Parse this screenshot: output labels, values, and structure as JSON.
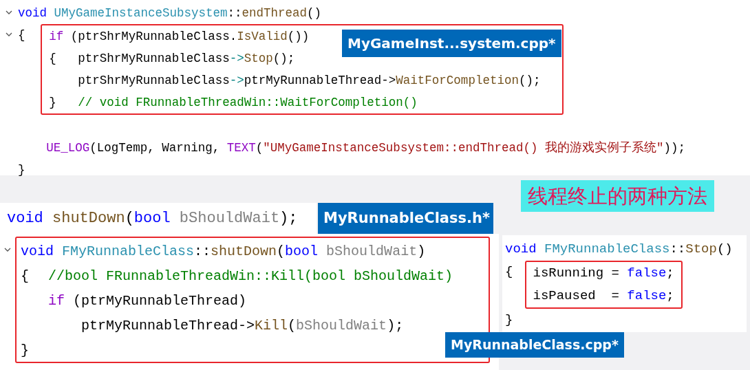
{
  "top_panel": {
    "file_tab": "MyGameInst...system.cpp*",
    "framed": false,
    "head_expanded": true,
    "lead_expanded": true,
    "head": [
      {
        "kind": "kw",
        "text": "void "
      },
      {
        "kind": "cls",
        "text": "UMyGameInstanceSubsystem"
      },
      {
        "kind": "plain",
        "text": "::"
      },
      {
        "kind": "fn",
        "text": "endThread"
      },
      {
        "kind": "plain",
        "text": "()"
      }
    ],
    "lead": "{",
    "groups": [
      {
        "framed": true,
        "lines": [
          [
            {
              "kind": "ctl",
              "text": "if"
            },
            {
              "kind": "plain",
              "text": " (ptrShrMyRunnableClass."
            },
            {
              "kind": "fn",
              "text": "IsValid"
            },
            {
              "kind": "plain",
              "text": "())"
            }
          ],
          [
            {
              "kind": "plain",
              "text": "{   ptrShrMyRunnableClass"
            },
            {
              "kind": "op",
              "text": "->"
            },
            {
              "kind": "fn",
              "text": "Stop"
            },
            {
              "kind": "plain",
              "text": "();"
            }
          ],
          [
            {
              "kind": "plain",
              "text": "    ptrShrMyRunnableClass"
            },
            {
              "kind": "op",
              "text": "->"
            },
            {
              "kind": "plain",
              "text": "ptrMyRunnableThread->"
            },
            {
              "kind": "fn",
              "text": "WaitForCompletion"
            },
            {
              "kind": "plain",
              "text": "();"
            }
          ],
          [
            {
              "kind": "plain",
              "text": "}   "
            },
            {
              "kind": "cmt",
              "text": "// void FRunnableThreadWin::WaitForCompletion()"
            }
          ]
        ]
      },
      {
        "framed": false,
        "lines": [
          [
            {
              "kind": "ctl",
              "text": "UE_LOG"
            },
            {
              "kind": "plain",
              "text": "(LogTemp, Warning, "
            },
            {
              "kind": "ctl",
              "text": "TEXT"
            },
            {
              "kind": "plain",
              "text": "("
            },
            {
              "kind": "str",
              "text": "\"UMyGameInstanceSubsystem::endThread() 我的游戏实例子系统\""
            },
            {
              "kind": "plain",
              "text": "));"
            }
          ]
        ]
      }
    ],
    "close": "}"
  },
  "title_label": "线程终止的两种方法",
  "declaration": {
    "file_tab": "MyRunnableClass.h*",
    "tokens": [
      {
        "kind": "kw",
        "text": "void "
      },
      {
        "kind": "fn",
        "text": "shutDown"
      },
      {
        "kind": "plain",
        "text": "("
      },
      {
        "kind": "kw",
        "text": "bool "
      },
      {
        "kind": "param",
        "text": "bShouldWait"
      },
      {
        "kind": "plain",
        "text": ");"
      }
    ]
  },
  "left_panel": {
    "file_tab": "MyRunnableClass.cpp*",
    "framed": true,
    "head_expanded": true,
    "head": [
      {
        "kind": "kw",
        "text": "void "
      },
      {
        "kind": "cls",
        "text": "FMyRunnableClass"
      },
      {
        "kind": "plain",
        "text": "::"
      },
      {
        "kind": "fn",
        "text": "shutDown"
      },
      {
        "kind": "plain",
        "text": "("
      },
      {
        "kind": "kw",
        "text": "bool "
      },
      {
        "kind": "param",
        "text": "bShouldWait"
      },
      {
        "kind": "plain",
        "text": ")"
      }
    ],
    "lead": "{",
    "groups": [
      {
        "framed": false,
        "lines": [
          [
            {
              "kind": "cmt",
              "text": "//bool FRunnableThreadWin::Kill(bool bShouldWait)"
            }
          ],
          [
            {
              "kind": "ctl",
              "text": "if"
            },
            {
              "kind": "plain",
              "text": " (ptrMyRunnableThread)"
            }
          ],
          [
            {
              "kind": "plain",
              "text": "    ptrMyRunnableThread->"
            },
            {
              "kind": "fn",
              "text": "Kill"
            },
            {
              "kind": "plain",
              "text": "("
            },
            {
              "kind": "param",
              "text": "bShouldWait"
            },
            {
              "kind": "plain",
              "text": ");"
            }
          ]
        ]
      }
    ],
    "close": "}"
  },
  "right_panel": {
    "framed": false,
    "head": [
      {
        "kind": "kw",
        "text": "void "
      },
      {
        "kind": "cls",
        "text": "FMyRunnableClass"
      },
      {
        "kind": "plain",
        "text": "::"
      },
      {
        "kind": "fn",
        "text": "Stop"
      },
      {
        "kind": "plain",
        "text": "()"
      }
    ],
    "lead": "{",
    "groups": [
      {
        "framed": true,
        "lines": [
          [
            {
              "kind": "plain",
              "text": "isRunning = "
            },
            {
              "kind": "kw",
              "text": "false"
            },
            {
              "kind": "plain",
              "text": ";"
            }
          ],
          [
            {
              "kind": "plain",
              "text": "isPaused  = "
            },
            {
              "kind": "kw",
              "text": "false"
            },
            {
              "kind": "plain",
              "text": ";"
            }
          ]
        ]
      }
    ],
    "close": "}"
  }
}
